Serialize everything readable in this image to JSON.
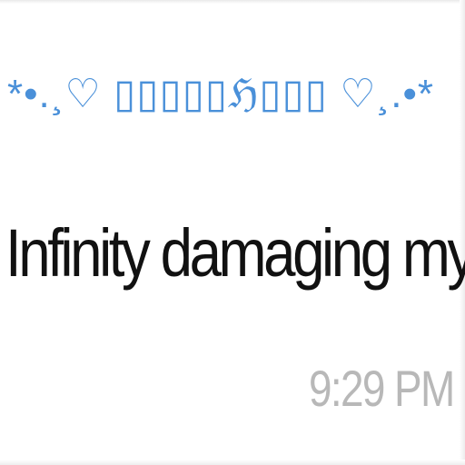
{
  "message": {
    "sender_display_name": "*•.¸♡ ▯▯▯▯▯ℌ▯▯▯ ♡¸.•*",
    "text": "Infinity damaging my device",
    "timestamp": "9:29 PM"
  },
  "colors": {
    "sender_name": "#4a90d9",
    "message_text": "#111111",
    "timestamp": "#b8b8b8",
    "background": "#ffffff"
  }
}
